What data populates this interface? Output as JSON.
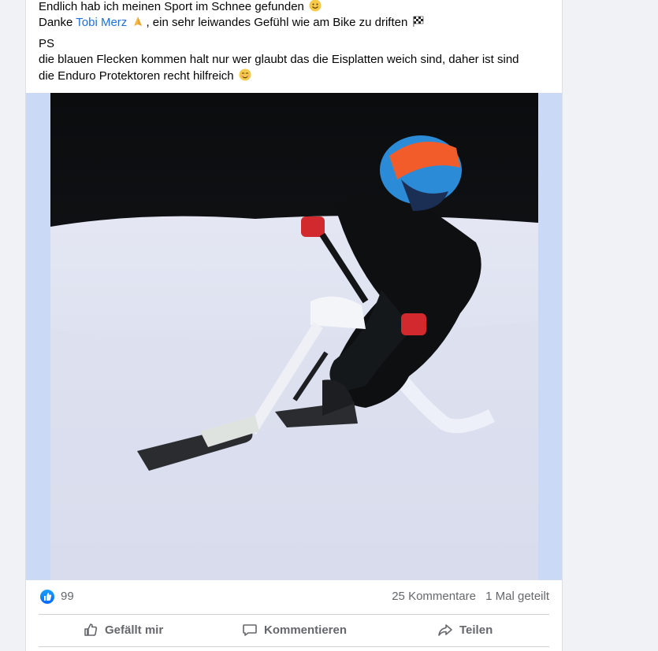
{
  "post": {
    "line1": "Endlich hab ich meinen Sport im Schnee gefunden",
    "line2_prefix": "Danke",
    "mention": "Tobi Merz",
    "line2_suffix": ", ein sehr leiwandes Gefühl wie am Bike zu driften",
    "line3": "PS",
    "line4": "die blauen Flecken kommen halt nur wer glaubt das die Eisplatten weich sind, daher ist sind",
    "line5": "die Enduro Protektoren recht hilfreich",
    "emojis": [
      "smile-emoji",
      "folded-hands-emoji",
      "checkered-flag-emoji",
      "blush-emoji"
    ]
  },
  "stats": {
    "likes": "99",
    "comments": "25 Kommentare",
    "shares": "1 Mal geteilt"
  },
  "actions": {
    "like": "Gefällt mir",
    "comment": "Kommentieren",
    "share": "Teilen"
  },
  "colors": {
    "mention": "#216fdb",
    "like_blue": "#0866ff",
    "muted": "#65676b",
    "media_bg": "#c9d9f6"
  }
}
